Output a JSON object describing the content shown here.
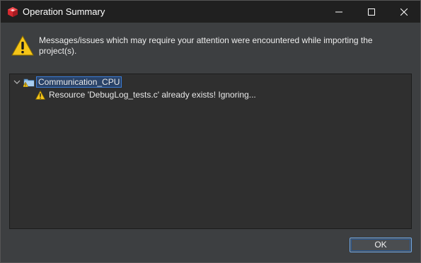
{
  "window": {
    "title": "Operation Summary",
    "icons": {
      "app": "red-cube-app-icon",
      "minimize": "minimize-icon",
      "maximize": "maximize-icon",
      "close": "close-icon"
    }
  },
  "message": {
    "icon": "warning-icon",
    "text": "Messages/issues which may require your attention were encountered while importing the project(s)."
  },
  "tree": {
    "project": {
      "label": "Communication_CPU",
      "expanded": true,
      "icon": "project-folder-warning-icon"
    },
    "issues": [
      {
        "icon": "warning-icon",
        "text": "Resource 'DebugLog_tests.c' already exists! Ignoring..."
      }
    ]
  },
  "buttons": {
    "ok_label": "OK"
  },
  "colors": {
    "title_bar": "#202020",
    "dialog_bg": "#3d3f41",
    "tree_bg": "#2f2f2f",
    "warning_yellow": "#f5c518",
    "selection_border": "#3a7bd5",
    "app_icon_red": "#d4282e"
  }
}
